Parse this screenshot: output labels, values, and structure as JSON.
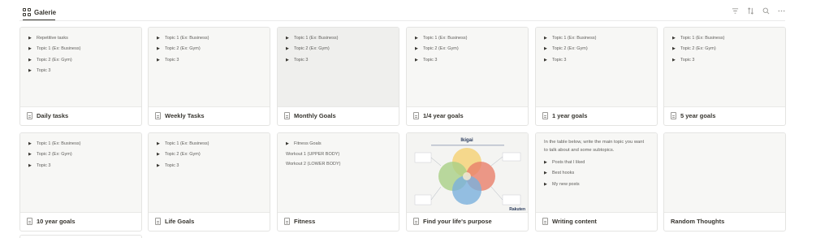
{
  "header": {
    "view_label": "Galerie"
  },
  "toolbar": {
    "filter_icon": "filter-icon",
    "sort_icon": "sort-icon",
    "search_icon": "search-icon",
    "more_icon": "more-icon"
  },
  "cards": [
    {
      "title": "Daily tasks",
      "lines": [
        "Repetitive tasks",
        "Topic 1 (Ex: Business)",
        "Topic 2 (Ex: Gym)",
        "Topic 3"
      ]
    },
    {
      "title": "Weekly Tasks",
      "lines": [
        "Topic 1 (Ex: Business)",
        "Topic 2 (Ex: Gym)",
        "Topic 3"
      ]
    },
    {
      "title": "Monthly Goals",
      "lines": [
        "Topic 1 (Ex: Business)",
        "Topic 2 (Ex: Gym)",
        "Topic 3"
      ]
    },
    {
      "title": "1/4 year goals",
      "lines": [
        "Topic 1 (Ex: Business)",
        "Topic 2 (Ex: Gym)",
        "Topic 3"
      ]
    },
    {
      "title": "1 year goals",
      "lines": [
        "Topic 1 (Ex: Business)",
        "Topic 2 (Ex: Gym)",
        "Topic 3"
      ]
    },
    {
      "title": "5 year goals",
      "lines": [
        "Topic 1 (Ex: Business)",
        "Topic 2 (Ex: Gym)",
        "Topic 3"
      ]
    },
    {
      "title": "10 year goals",
      "lines": [
        "Topic 1 (Ex: Business)",
        "Topic 2 (Ex: Gym)",
        "Topic 3"
      ]
    },
    {
      "title": "Life Goals",
      "lines": [
        "Topic 1 (Ex: Business)",
        "Topic 2 (Ex: Gym)",
        "Topic 3"
      ]
    },
    {
      "title": "Fitness",
      "toggle": "Fitness Goals",
      "plain": [
        "Workout 1 (UPPER BODY)",
        "Workout 2 (LOWER BODY)"
      ]
    },
    {
      "title": "Find your life's purpose",
      "image_title": "Ikigai",
      "image_brand": "Rakuten"
    },
    {
      "title": "Writing content",
      "paragraph": "In the table below, write the main topic you want to talk about and some subtopics.",
      "lines": [
        "Posts that I liked",
        "Best hooks",
        "My new posts"
      ]
    },
    {
      "title": "Random Thoughts"
    }
  ],
  "colors": {
    "accent_text": "#37352f",
    "muted_text": "#9b9a97",
    "border": "#e4e4e2",
    "preview_bg": "#f7f7f5"
  }
}
